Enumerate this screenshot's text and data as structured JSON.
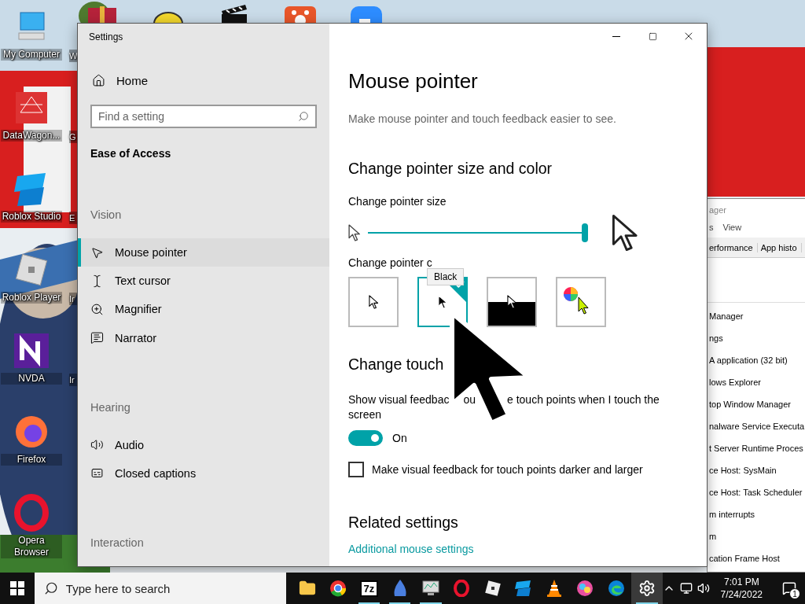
{
  "desktop": {
    "icons": [
      {
        "kind": "computer",
        "label": "My Computer"
      },
      {
        "kind": "datawagon",
        "label": "DataWagon..."
      },
      {
        "kind": "studio",
        "label": "Roblox Studio"
      },
      {
        "kind": "roblox",
        "label": "Roblox Player"
      },
      {
        "kind": "nvda",
        "label": "NVDA"
      },
      {
        "kind": "firefox",
        "label": "Firefox"
      },
      {
        "kind": "opera",
        "label": "Opera Browser"
      }
    ],
    "second_column_labels": [
      "W",
      "G",
      "E",
      "Ir",
      "Ir"
    ]
  },
  "settings": {
    "window": {
      "title": "Settings"
    },
    "home": "Home",
    "search": {
      "placeholder": "Find a setting"
    },
    "category": "Ease of Access",
    "nav": [
      {
        "kind": "heading",
        "label": "Vision"
      },
      {
        "kind": "pointer",
        "label": "Mouse pointer",
        "selected": true
      },
      {
        "kind": "cursor",
        "label": "Text cursor",
        "selected": false
      },
      {
        "kind": "magnifier",
        "label": "Magnifier",
        "selected": false
      },
      {
        "kind": "narrator",
        "label": "Narrator",
        "selected": false
      },
      {
        "kind": "heading",
        "label": "Hearing"
      },
      {
        "kind": "audio",
        "label": "Audio",
        "selected": false
      },
      {
        "kind": "captions",
        "label": "Closed captions",
        "selected": false
      },
      {
        "kind": "heading",
        "label": "Interaction"
      }
    ],
    "page": {
      "title": "Mouse pointer",
      "description": "Make mouse pointer and touch feedback easier to see.",
      "size_color_heading": "Change pointer size and color",
      "size_label": "Change pointer size",
      "size_slider": {
        "level": 1.0
      },
      "color_label": "Change pointer c",
      "color_tooltip": "Black",
      "colors": [
        {
          "kind": "white",
          "selected": false
        },
        {
          "kind": "black",
          "selected": true
        },
        {
          "kind": "inverted",
          "selected": false
        },
        {
          "kind": "custom",
          "selected": false
        }
      ],
      "touch_heading": "Change touch",
      "touch_text_parts": [
        "Show visual feedbac",
        "ou",
        "e touch points when I touch the",
        "screen"
      ],
      "touch_toggle": {
        "on": true,
        "label": "On"
      },
      "darker_checkbox": {
        "checked": false,
        "label": "Make visual feedback for touch points darker and larger"
      },
      "related_heading": "Related settings",
      "related_link": "Additional mouse settings"
    }
  },
  "task_manager": {
    "title": "ager",
    "menu": [
      "s",
      "View"
    ],
    "tabs": [
      "erformance",
      "App histo"
    ],
    "processes": [
      "Manager",
      "ngs",
      "A application (32 bit)",
      "lows Explorer",
      "top Window Manager",
      "nalware Service Executa",
      "t Server Runtime Proces",
      "ce Host: SysMain",
      "ce Host: Task Scheduler",
      "m interrupts",
      "m",
      "cation Frame Host"
    ]
  },
  "taskbar": {
    "search": {
      "placeholder": "Type here to search"
    },
    "apps": [
      {
        "kind": "explorer",
        "running": false,
        "active": false
      },
      {
        "kind": "chrome",
        "running": false,
        "active": false
      },
      {
        "kind": "archiver",
        "text": "7z",
        "running": true,
        "active": false
      },
      {
        "kind": "droplet",
        "running": true,
        "active": false
      },
      {
        "kind": "monitor",
        "running": true,
        "active": false
      },
      {
        "kind": "opera",
        "running": false,
        "active": false
      },
      {
        "kind": "roblox",
        "running": false,
        "active": false
      },
      {
        "kind": "studio",
        "running": false,
        "active": false
      },
      {
        "kind": "vlc",
        "running": false,
        "active": false
      },
      {
        "kind": "paint",
        "running": false,
        "active": false
      },
      {
        "kind": "edge",
        "running": false,
        "active": false
      },
      {
        "kind": "settings",
        "running": true,
        "active": true
      }
    ],
    "time": "7:01 PM",
    "date": "7/24/2022",
    "notification_count": "1"
  }
}
